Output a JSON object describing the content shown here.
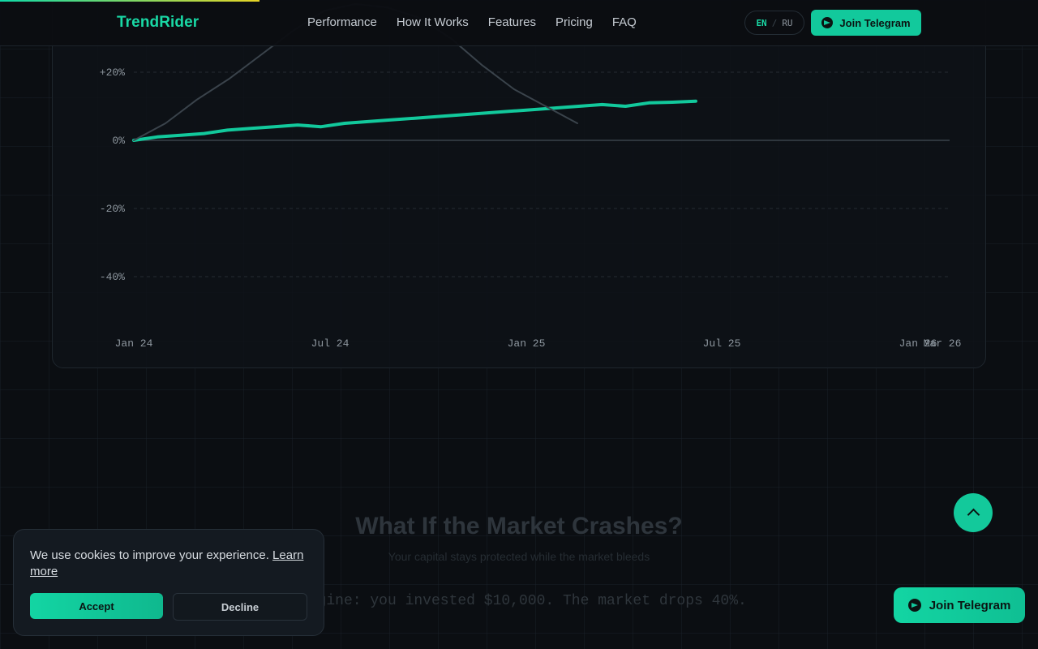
{
  "header": {
    "logo": "TrendRider",
    "nav": [
      "Performance",
      "How It Works",
      "Features",
      "Pricing",
      "FAQ"
    ],
    "lang": {
      "en": "EN",
      "separator": "/",
      "ru": "RU"
    },
    "telegram_label": "Join Telegram"
  },
  "scroll_progress": 0.25,
  "chart_data": {
    "type": "line",
    "y_ticks": [
      "+20%",
      "0%",
      "-20%",
      "-40%"
    ],
    "x_ticks": [
      "Jan 24",
      "Jul 24",
      "Jan 25",
      "Jul 25",
      "Jan 26",
      "Mar 26"
    ],
    "ylim": [
      -50,
      30
    ],
    "grid": true,
    "series": [
      {
        "values": [
          0,
          1,
          1.5,
          2,
          3,
          3.5,
          4,
          4.5,
          4,
          5,
          5.5,
          6,
          6.5,
          7,
          7.5,
          8,
          8.5,
          9,
          9.5,
          10,
          10.5,
          10,
          11,
          11.2,
          11.5
        ],
        "color": "#12c99c"
      },
      {
        "values": [
          0,
          5,
          12,
          18,
          25,
          32,
          38,
          40,
          39,
          36,
          30,
          22,
          15,
          10,
          5
        ],
        "color": "#3a434b"
      }
    ]
  },
  "crash": {
    "title": "What If the Market Crashes?",
    "subtitle": "Your capital stays protected while the market bleeds",
    "text": "Imagine: you invested $10,000. The market drops 40%."
  },
  "cookie": {
    "text": "We use cookies to improve your experience.",
    "link": "Learn more",
    "accept": "Accept",
    "decline": "Decline"
  },
  "float_telegram_label": "Join Telegram"
}
